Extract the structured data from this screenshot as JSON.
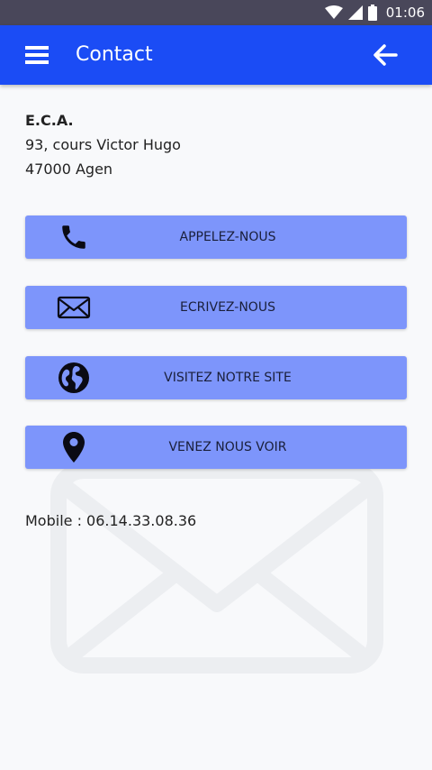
{
  "status_bar": {
    "time": "01:06",
    "icons": [
      "wifi-icon",
      "signal-icon",
      "battery-icon"
    ]
  },
  "app_bar": {
    "title": "Contact",
    "menu_icon": "hamburger-menu-icon",
    "back_icon": "arrow-left-icon",
    "color": "#1b4cf5"
  },
  "address": {
    "company": "E.C.A.",
    "street": "93, cours Victor Hugo",
    "city": "47000 Agen"
  },
  "actions": [
    {
      "label": "APPELEZ-NOUS",
      "icon": "phone-icon"
    },
    {
      "label": "ECRIVEZ-NOUS",
      "icon": "envelope-icon"
    },
    {
      "label": "VISITEZ NOTRE SITE",
      "icon": "globe-icon"
    },
    {
      "label": "VENEZ NOUS VOIR",
      "icon": "map-pin-icon"
    }
  ],
  "button_color": "#7d95fb",
  "mobile": "Mobile : 06.14.33.08.36",
  "watermark_icon": "envelope-watermark-icon"
}
